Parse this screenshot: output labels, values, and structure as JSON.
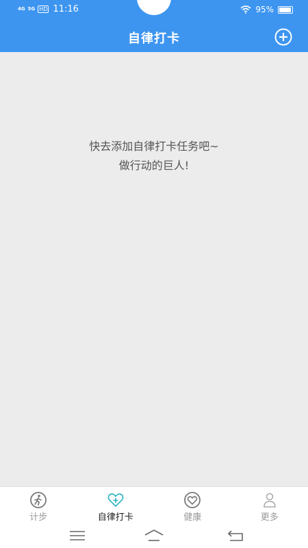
{
  "status_bar": {
    "net1": "4G",
    "net2": "5G",
    "hd": "HD",
    "time": "11:16",
    "battery": "95%",
    "battery_level": 0.95
  },
  "header": {
    "title": "自律打卡",
    "add_icon": "plus-circle-icon"
  },
  "main": {
    "empty_line1": "快去添加自律打卡任务吧~",
    "empty_line2": "做行动的巨人!"
  },
  "tabs": [
    {
      "label": "计步",
      "icon": "walker-icon",
      "active": false
    },
    {
      "label": "自律打卡",
      "icon": "heart-plus-icon",
      "active": true
    },
    {
      "label": "健康",
      "icon": "heart-circle-icon",
      "active": false
    },
    {
      "label": "更多",
      "icon": "person-icon",
      "active": false
    }
  ],
  "colors": {
    "primary": "#3D95F0",
    "accent": "#2BB3C0",
    "inactive": "#999999",
    "background": "#ECECEC"
  },
  "system_nav": [
    "menu-icon",
    "home-icon",
    "back-icon"
  ]
}
